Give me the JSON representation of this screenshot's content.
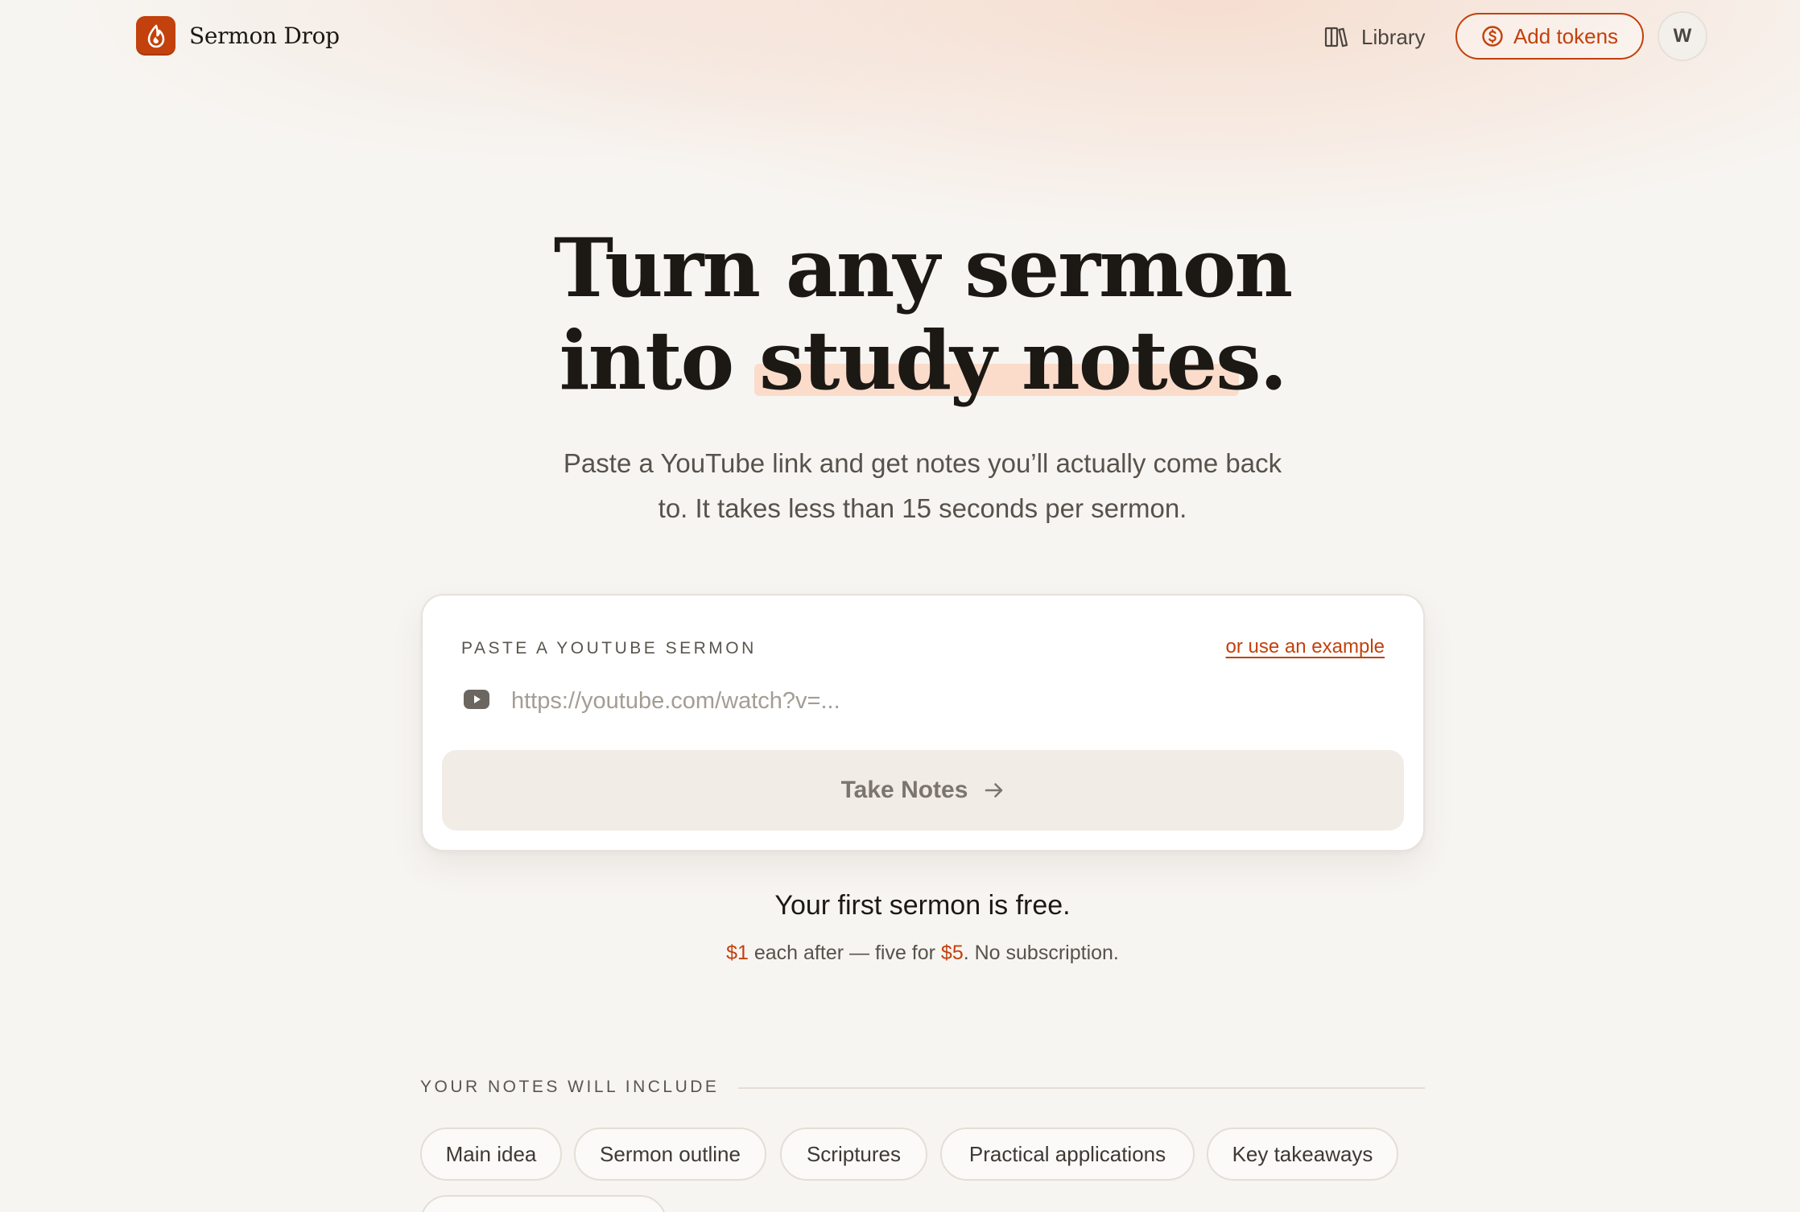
{
  "app": {
    "name": "Sermon Drop",
    "brand_color": "#c2410c"
  },
  "header": {
    "library_label": "Library",
    "add_tokens_label": "Add tokens",
    "avatar_initial": "W",
    "icons": {
      "brand": "flame-drop-icon",
      "library": "books-icon",
      "tokens": "dollar-coin-icon"
    }
  },
  "hero": {
    "title_line1": "Turn any sermon",
    "title_line2_prefix": "into ",
    "title_line2_highlight": "study notes",
    "title_line2_suffix": ".",
    "subtitle": "Paste a YouTube link and get notes you’ll actually come back to. It takes less than 15 seconds per sermon."
  },
  "input_card": {
    "label": "PASTE A YOUTUBE SERMON",
    "example_link": "or use an example",
    "url_value": "",
    "url_placeholder": "https://youtube.com/watch?v=...",
    "submit_label": "Take Notes",
    "icons": {
      "input": "youtube-icon",
      "submit": "arrow-right-icon"
    }
  },
  "pricing": {
    "headline": "Your first sermon is free.",
    "price_single": "$1",
    "text_middle": " each after — five for ",
    "price_bundle": "$5",
    "text_end": ". No subscription."
  },
  "includes": {
    "label": "YOUR NOTES WILL INCLUDE",
    "items": [
      "Main idea",
      "Sermon outline",
      "Scriptures",
      "Practical applications",
      "Key takeaways",
      ""
    ]
  }
}
